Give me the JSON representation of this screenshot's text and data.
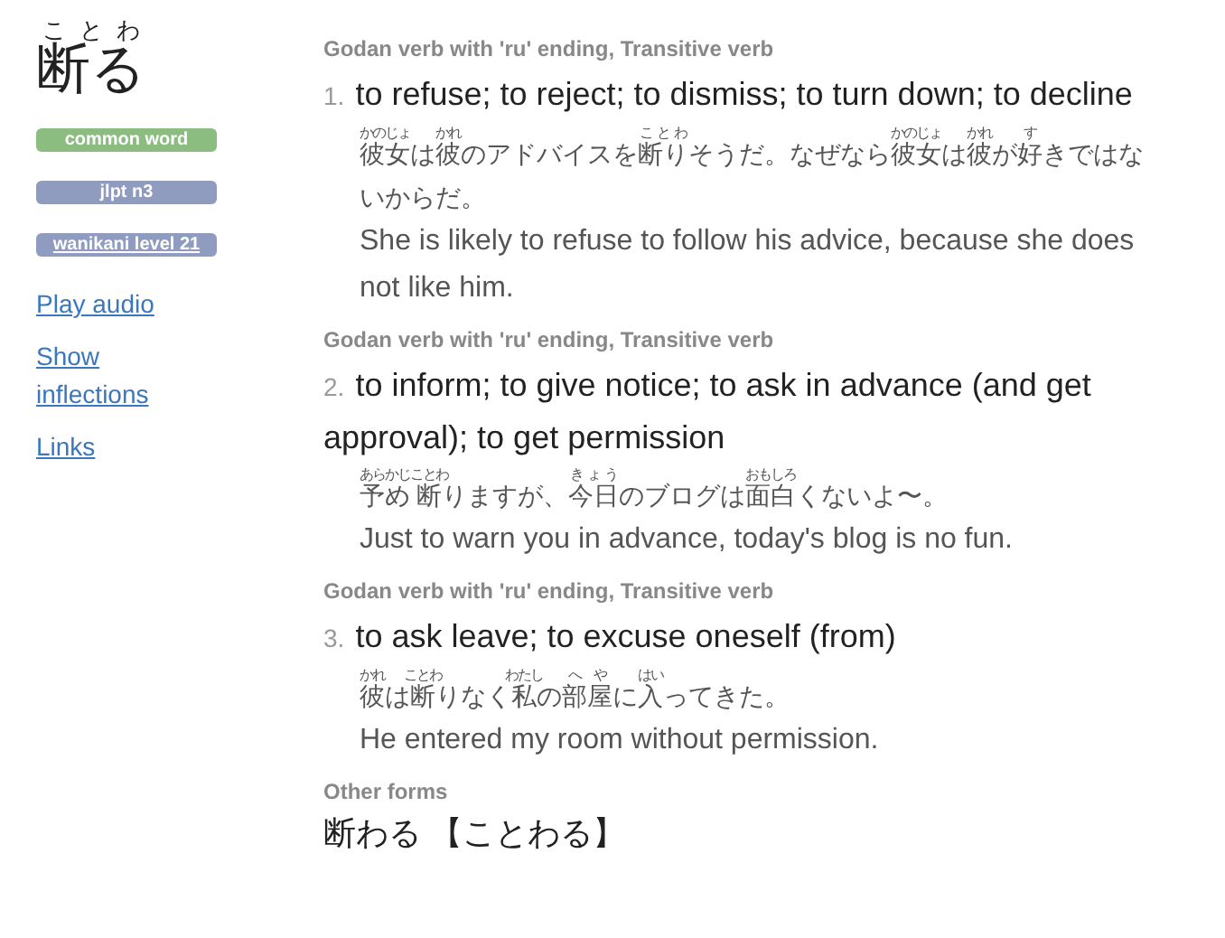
{
  "word": {
    "reading": "ことわ",
    "text": "断る"
  },
  "tags": [
    {
      "label": "common word",
      "color": "#8bbd81",
      "linked": false
    },
    {
      "label": "jlpt n3",
      "color": "#8f9cc0",
      "linked": false
    },
    {
      "label": "wanikani level 21",
      "color": "#8f9cc0",
      "linked": true
    }
  ],
  "links": [
    "Play audio",
    "Show inflections",
    "Links"
  ],
  "senses": [
    {
      "pos": "Godan verb with 'ru' ending, Transitive verb",
      "number": "1.",
      "meaning": "to refuse; to reject; to dismiss; to turn down; to decline",
      "examples": [
        {
          "japanese": [
            {
              "text": "彼女",
              "ruby": "かのじょ"
            },
            {
              "text": "は"
            },
            {
              "text": "彼",
              "ruby": "かれ"
            },
            {
              "text": "のアドバイスを"
            },
            {
              "text": "断り",
              "ruby": "ことわ"
            },
            {
              "text": "そうだ。なぜなら"
            },
            {
              "text": "彼女",
              "ruby": "かのじょ"
            },
            {
              "text": "は"
            },
            {
              "text": "彼",
              "ruby": "かれ"
            },
            {
              "text": "が"
            },
            {
              "text": "好",
              "ruby": "す"
            },
            {
              "text": "きではないからだ。"
            }
          ],
          "english": "She is likely to refuse to follow his advice, because she does not like him."
        }
      ]
    },
    {
      "pos": "Godan verb with 'ru' ending, Transitive verb",
      "number": "2.",
      "meaning": "to inform; to give notice; to ask in advance (and get approval); to get permission",
      "examples": [
        {
          "japanese": [
            {
              "text": "予め",
              "ruby": "あらかじ"
            },
            {
              "text": "断",
              "ruby": "ことわ"
            },
            {
              "text": "りますが、"
            },
            {
              "text": "今日",
              "ruby": "きょう"
            },
            {
              "text": "のブログは"
            },
            {
              "text": "面白",
              "ruby": "おもしろ"
            },
            {
              "text": "くないよ〜。"
            }
          ],
          "english": "Just to warn you in advance, today's blog is no fun."
        }
      ]
    },
    {
      "pos": "Godan verb with 'ru' ending, Transitive verb",
      "number": "3.",
      "meaning": "to ask leave; to excuse oneself (from)",
      "examples": [
        {
          "japanese": [
            {
              "text": "彼",
              "ruby": "かれ"
            },
            {
              "text": "は"
            },
            {
              "text": "断",
              "ruby": "ことわ"
            },
            {
              "text": "りなく"
            },
            {
              "text": "私",
              "ruby": "わたし"
            },
            {
              "text": "の"
            },
            {
              "text": "部屋",
              "ruby": "へや"
            },
            {
              "text": "に"
            },
            {
              "text": "入",
              "ruby": "はい"
            },
            {
              "text": "ってきた。"
            }
          ],
          "english": "He entered my room without permission."
        }
      ]
    }
  ],
  "other_forms": {
    "label": "Other forms",
    "items": [
      "断わる 【ことわる】"
    ]
  }
}
